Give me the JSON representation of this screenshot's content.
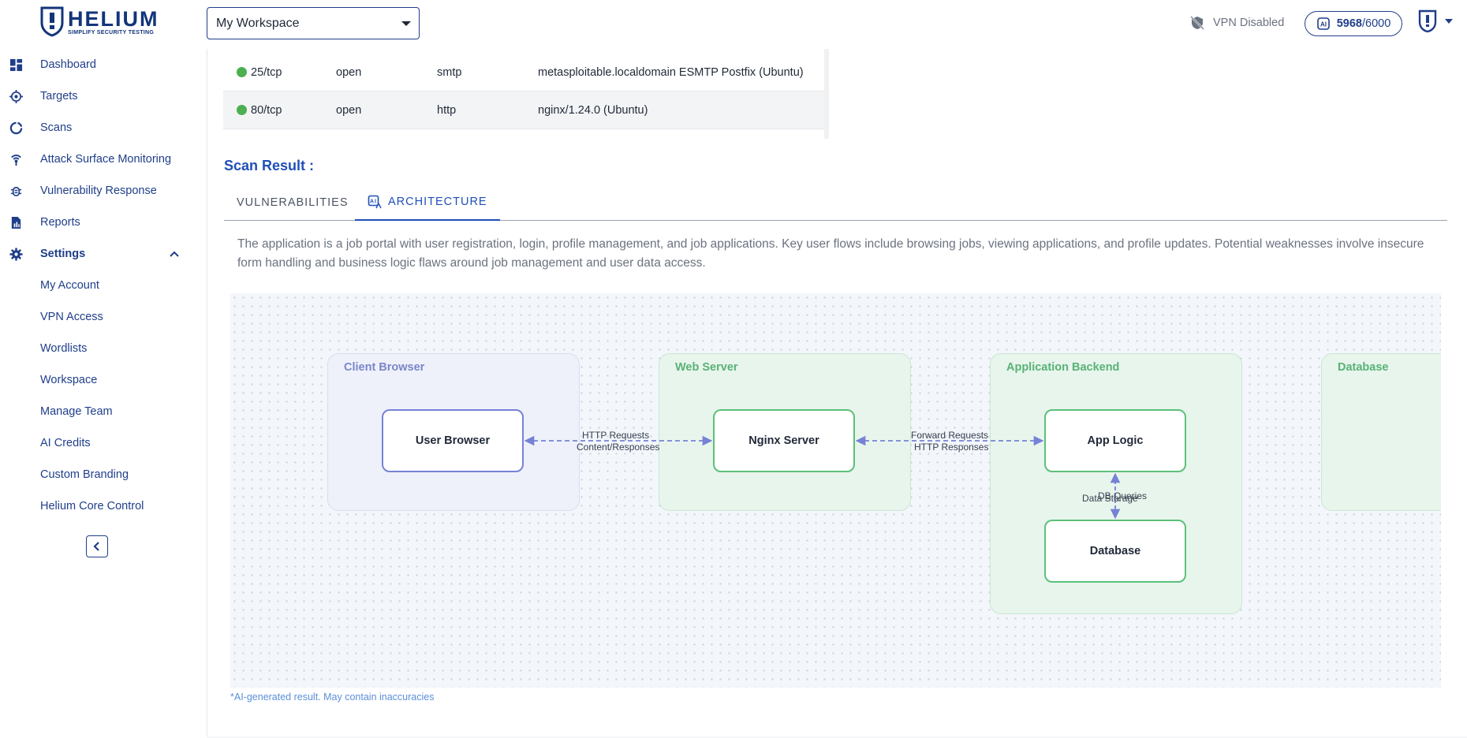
{
  "brand": {
    "name": "HELIUM",
    "tagline": "SIMPLIFY SECURITY TESTING"
  },
  "sidebar": {
    "items": [
      {
        "label": "Dashboard",
        "icon": "dashboard-icon"
      },
      {
        "label": "Targets",
        "icon": "target-icon"
      },
      {
        "label": "Scans",
        "icon": "scan-icon"
      },
      {
        "label": "Attack Surface Monitoring",
        "icon": "antenna-icon"
      },
      {
        "label": "Vulnerability Response",
        "icon": "bug-icon"
      },
      {
        "label": "Reports",
        "icon": "report-icon"
      },
      {
        "label": "Settings",
        "icon": "gear-icon"
      }
    ],
    "settings_children": [
      "My Account",
      "VPN Access",
      "Wordlists",
      "Workspace",
      "Manage Team",
      "AI Credits",
      "Custom Branding",
      "Helium Core Control"
    ]
  },
  "header": {
    "workspace": "My Workspace",
    "vpn_status": "VPN Disabled",
    "credits_used": "5968",
    "credits_total": "/6000"
  },
  "ports": [
    {
      "port": "25/tcp",
      "state": "open",
      "service": "smtp",
      "version": "metasploitable.localdomain ESMTP Postfix (Ubuntu)",
      "status_color": "#4caf50"
    },
    {
      "port": "80/tcp",
      "state": "open",
      "service": "http",
      "version": "nginx/1.24.0 (Ubuntu)",
      "status_color": "#4caf50"
    }
  ],
  "scan": {
    "title": "Scan Result :",
    "tabs": [
      "VULNERABILITIES",
      "ARCHITECTURE"
    ],
    "active_tab": "ARCHITECTURE",
    "description": "The application is a job portal with user registration, login, profile management, and job applications. Key user flows include browsing jobs, viewing applications, and profile updates. Potential weaknesses involve insecure form handling and business logic flaws around job management and user data access."
  },
  "architecture": {
    "groups": [
      "Client Browser",
      "Web Server",
      "Application Backend",
      "Database"
    ],
    "nodes": [
      "User Browser",
      "Nginx Server",
      "App Logic",
      "Database"
    ],
    "edges": [
      {
        "from": "User Browser",
        "to": "Nginx Server",
        "labels": [
          "HTTP Requests",
          "Content/Responses"
        ]
      },
      {
        "from": "Nginx Server",
        "to": "App Logic",
        "labels": [
          "Forward Requests",
          "HTTP Responses"
        ]
      },
      {
        "from": "App Logic",
        "to": "Database",
        "labels": [
          "DB Queries",
          "Data Storage"
        ]
      }
    ],
    "ai_note": "*AI-generated result. May contain inaccuracies"
  },
  "colors": {
    "primary": "#1f3e8a",
    "accent": "#1f4fb8",
    "edge": "#7582d6",
    "green": "#5cc07a"
  }
}
